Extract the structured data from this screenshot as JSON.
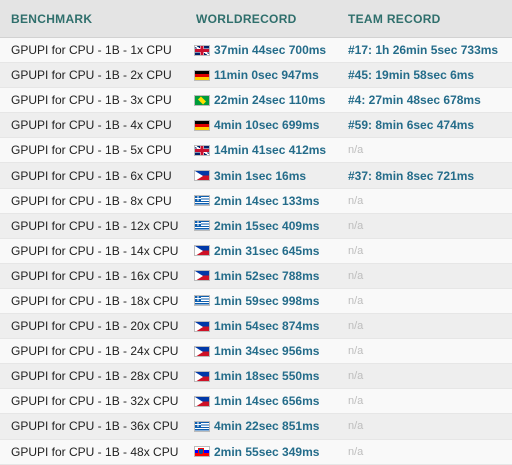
{
  "header": {
    "benchmark": "BENCHMARK",
    "worldrecord": "WORLDRECORD",
    "team_record": "TEAM RECORD"
  },
  "rows": [
    {
      "benchmark": "GPUPI for CPU - 1B - 1x CPU",
      "flag": "gb-flag-icon",
      "world": "37min 44sec 700ms",
      "team": "#17: 1h 26min 5sec 733ms"
    },
    {
      "benchmark": "GPUPI for CPU - 1B - 2x CPU",
      "flag": "de-flag-icon",
      "world": "11min 0sec 947ms",
      "team": "#45: 19min 58sec 6ms"
    },
    {
      "benchmark": "GPUPI for CPU - 1B - 3x CPU",
      "flag": "br-flag-icon",
      "world": "22min 24sec 110ms",
      "team": "#4: 27min 48sec 678ms"
    },
    {
      "benchmark": "GPUPI for CPU - 1B - 4x CPU",
      "flag": "de-flag-icon",
      "world": "4min 10sec 699ms",
      "team": "#59: 8min 6sec 474ms"
    },
    {
      "benchmark": "GPUPI for CPU - 1B - 5x CPU",
      "flag": "gb-flag-icon",
      "world": "14min 41sec 412ms",
      "team": "n/a"
    },
    {
      "benchmark": "GPUPI for CPU - 1B - 6x CPU",
      "flag": "ph-flag-icon",
      "world": "3min 1sec 16ms",
      "team": "#37: 8min 8sec 721ms"
    },
    {
      "benchmark": "GPUPI for CPU - 1B - 8x CPU",
      "flag": "gr-flag-icon",
      "world": "2min 14sec 133ms",
      "team": "n/a"
    },
    {
      "benchmark": "GPUPI for CPU - 1B - 12x CPU",
      "flag": "gr-flag-icon",
      "world": "2min 15sec 409ms",
      "team": "n/a"
    },
    {
      "benchmark": "GPUPI for CPU - 1B - 14x CPU",
      "flag": "ph-flag-icon",
      "world": "2min 31sec 645ms",
      "team": "n/a"
    },
    {
      "benchmark": "GPUPI for CPU - 1B - 16x CPU",
      "flag": "ph-flag-icon",
      "world": "1min 52sec 788ms",
      "team": "n/a"
    },
    {
      "benchmark": "GPUPI for CPU - 1B - 18x CPU",
      "flag": "gr-flag-icon",
      "world": "1min 59sec 998ms",
      "team": "n/a"
    },
    {
      "benchmark": "GPUPI for CPU - 1B - 20x CPU",
      "flag": "ph-flag-icon",
      "world": "1min 54sec 874ms",
      "team": "n/a"
    },
    {
      "benchmark": "GPUPI for CPU - 1B - 24x CPU",
      "flag": "ph-flag-icon",
      "world": "1min 34sec 956ms",
      "team": "n/a"
    },
    {
      "benchmark": "GPUPI for CPU - 1B - 28x CPU",
      "flag": "ph-flag-icon",
      "world": "1min 18sec 550ms",
      "team": "n/a"
    },
    {
      "benchmark": "GPUPI for CPU - 1B - 32x CPU",
      "flag": "ph-flag-icon",
      "world": "1min 14sec 656ms",
      "team": "n/a"
    },
    {
      "benchmark": "GPUPI for CPU - 1B - 36x CPU",
      "flag": "gr-flag-icon",
      "world": "4min 22sec 851ms",
      "team": "n/a"
    },
    {
      "benchmark": "GPUPI for CPU - 1B - 48x CPU",
      "flag": "si-flag-icon",
      "world": "2min 55sec 349ms",
      "team": "n/a"
    }
  ],
  "colors": {
    "header_text": "#2f6f6c",
    "link_text": "#246c8a",
    "na_text": "#bdbdbd"
  }
}
